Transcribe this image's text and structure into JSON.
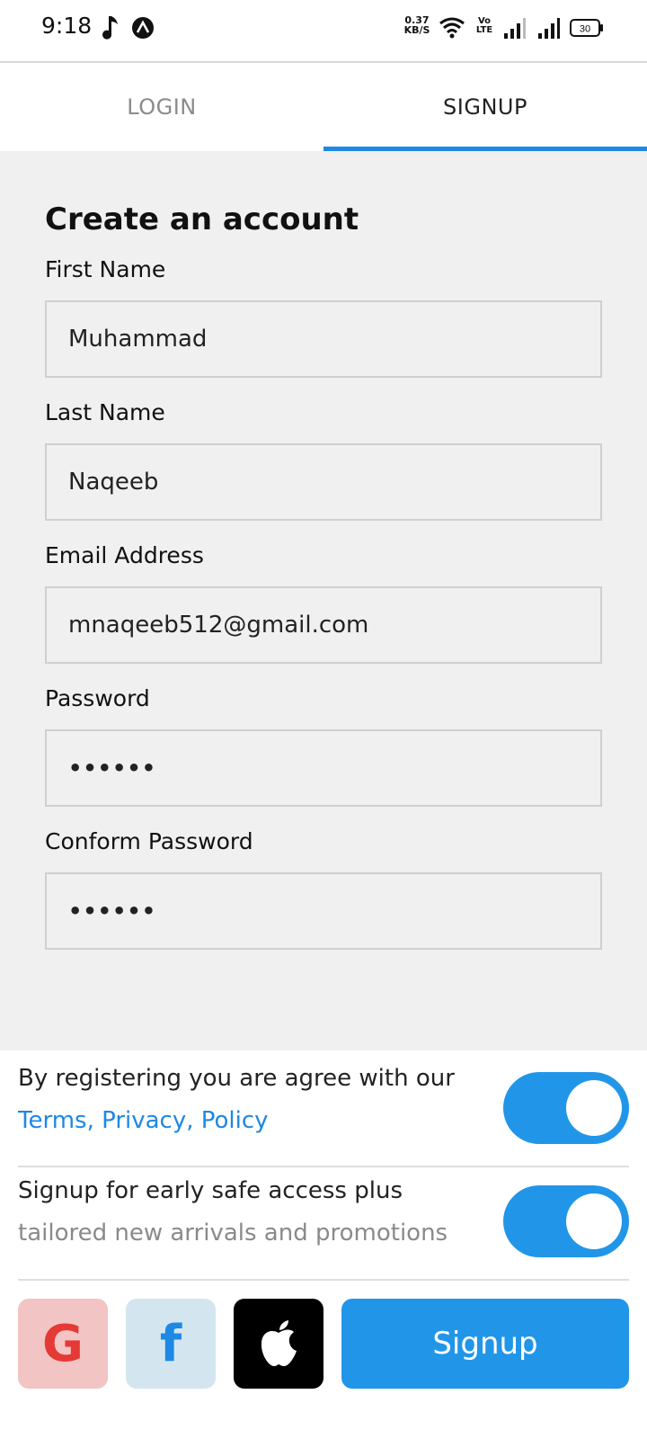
{
  "status_bar": {
    "time": "9:18",
    "net_speed_value": "0.37",
    "net_speed_unit": "KB/S",
    "volte_line1": "Vo",
    "volte_line2": "LTE",
    "battery": "30",
    "icons": [
      "music-note-icon",
      "app-notification-icon",
      "wifi-icon",
      "volte-icon",
      "signal-icon",
      "signal-icon",
      "battery-icon"
    ]
  },
  "tabs": [
    {
      "label": "LOGIN",
      "active": false
    },
    {
      "label": "SIGNUP",
      "active": true
    }
  ],
  "form": {
    "title": "Create an account",
    "fields": [
      {
        "label": "First Name",
        "value": "Muhammad"
      },
      {
        "label": "Last Name",
        "value": "Naqeeb"
      },
      {
        "label": "Email Address",
        "value": "mnaqeeb512@gmail.com"
      },
      {
        "label": "Password",
        "value": "••••••"
      },
      {
        "label": "Conform Password",
        "value": "••••••"
      }
    ]
  },
  "agreement": {
    "terms_text": "By registering you are agree with our",
    "terms_link": "Terms, Privacy, Policy",
    "terms_toggle_on": true,
    "promo_line1": "Signup for early safe access plus",
    "promo_line2": "tailored new arrivals and promotions",
    "promo_toggle_on": true
  },
  "actions": {
    "google_letter": "G",
    "facebook_letter": "f",
    "signup_label": "Signup"
  },
  "colors": {
    "accent": "#2196e8",
    "tab_indicator": "#1e88e5",
    "google": "#e53935",
    "google_bg": "#f2c4c4",
    "facebook_bg": "#d3e6ef",
    "apple_bg": "#000000"
  }
}
